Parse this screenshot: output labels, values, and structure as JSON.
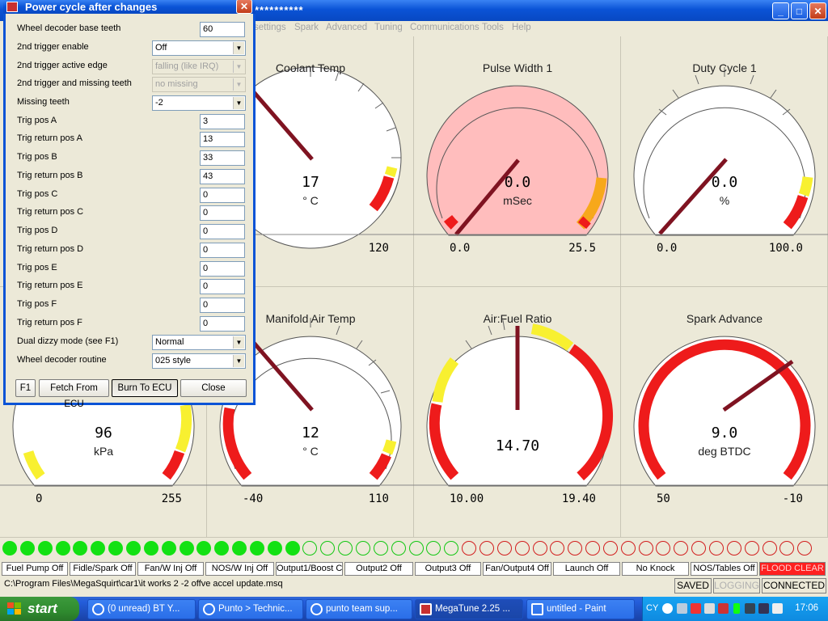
{
  "main_window": {
    "title": "**********",
    "menu": [
      "settings",
      "Spark",
      "Advanced",
      "Tuning",
      "Communications",
      "Tools",
      "Help"
    ]
  },
  "gauges": [
    {
      "title": "",
      "value": "",
      "units": "",
      "min": "",
      "max": ""
    },
    {
      "title": "Coolant Temp",
      "value": "17",
      "units": "° C",
      "min": "",
      "max": "120"
    },
    {
      "title": "Pulse Width 1",
      "value": "0.0",
      "units": "mSec",
      "min": "0.0",
      "max": "25.5"
    },
    {
      "title": "Duty Cycle 1",
      "value": "0.0",
      "units": "%",
      "min": "0.0",
      "max": "100.0"
    },
    {
      "title": "",
      "value": "96",
      "units": "kPa",
      "min": "0",
      "max": "255"
    },
    {
      "title": "Manifold Air Temp",
      "value": "12",
      "units": "° C",
      "min": "-40",
      "max": "110"
    },
    {
      "title": "Air:Fuel Ratio",
      "value": "14.70",
      "units": "",
      "min": "10.00",
      "max": "19.40"
    },
    {
      "title": "Spark Advance",
      "value": "9.0",
      "units": "deg BTDC",
      "min": "50",
      "max": "-10"
    }
  ],
  "leds": {
    "green_on": 17,
    "green_off": 9,
    "red_off": 20
  },
  "status_indicators": [
    "Fuel Pump Off",
    "Fidle/Spark Off",
    "Fan/W Inj Off",
    "NOS/W Inj Off",
    "Output1/Boost C",
    "Output2 Off",
    "Output3 Off",
    "Fan/Output4 Off",
    "Launch Off",
    "No Knock",
    "NOS/Tables Off",
    "FLOOD CLEAR"
  ],
  "status_bar": {
    "path": "C:\\Program Files\\MegaSquirt\\car1\\it works 2 -2 offve accel update.msq",
    "saved": "SAVED",
    "logging": "LOGGING",
    "connected": "CONNECTED"
  },
  "dialog": {
    "title": "Power cycle after changes",
    "fields": [
      {
        "label": "Wheel decoder base teeth",
        "type": "input",
        "value": "60"
      },
      {
        "label": "2nd trigger enable",
        "type": "select",
        "value": "Off"
      },
      {
        "label": "2nd trigger active edge",
        "type": "select-disabled",
        "value": "falling (like IRQ)"
      },
      {
        "label": "2nd trigger and missing teeth",
        "type": "select-disabled",
        "value": "no missing"
      },
      {
        "label": "Missing teeth",
        "type": "select",
        "value": "-2"
      },
      {
        "label": "Trig pos A",
        "type": "input",
        "value": "3"
      },
      {
        "label": "Trig return pos A",
        "type": "input",
        "value": "13"
      },
      {
        "label": "Trig pos B",
        "type": "input",
        "value": "33"
      },
      {
        "label": "Trig return pos B",
        "type": "input",
        "value": "43"
      },
      {
        "label": "Trig pos C",
        "type": "input",
        "value": "0"
      },
      {
        "label": "Trig return pos C",
        "type": "input",
        "value": "0"
      },
      {
        "label": "Trig pos D",
        "type": "input",
        "value": "0"
      },
      {
        "label": "Trig return pos D",
        "type": "input",
        "value": "0"
      },
      {
        "label": "Trig pos E",
        "type": "input",
        "value": "0"
      },
      {
        "label": "Trig return pos E",
        "type": "input",
        "value": "0"
      },
      {
        "label": "Trig pos F",
        "type": "input",
        "value": "0"
      },
      {
        "label": "Trig return pos F",
        "type": "input",
        "value": "0"
      },
      {
        "label": "Dual dizzy mode (see F1)",
        "type": "select",
        "value": "Normal"
      },
      {
        "label": "Wheel decoder routine",
        "type": "select",
        "value": "025 style"
      }
    ],
    "buttons": {
      "f1": "F1",
      "fetch": "Fetch From ECU",
      "burn": "Burn To ECU",
      "close": "Close"
    }
  },
  "taskbar": {
    "start": "start",
    "items": [
      "(0 unread) BT Y...",
      "Punto > Technic...",
      "punto team sup...",
      "MegaTune 2.25 ...",
      "untitled - Paint"
    ],
    "lang": "CY",
    "clock": "17:06"
  },
  "colors": {
    "red_zone": "#ee1b1b",
    "yellow_zone": "#f8f030",
    "orange_zone": "#f7a81b",
    "needle": "#7f1321",
    "alarm_face": "#ffbdbd",
    "led_green": "#13e113",
    "led_red": "#d21e1e"
  }
}
